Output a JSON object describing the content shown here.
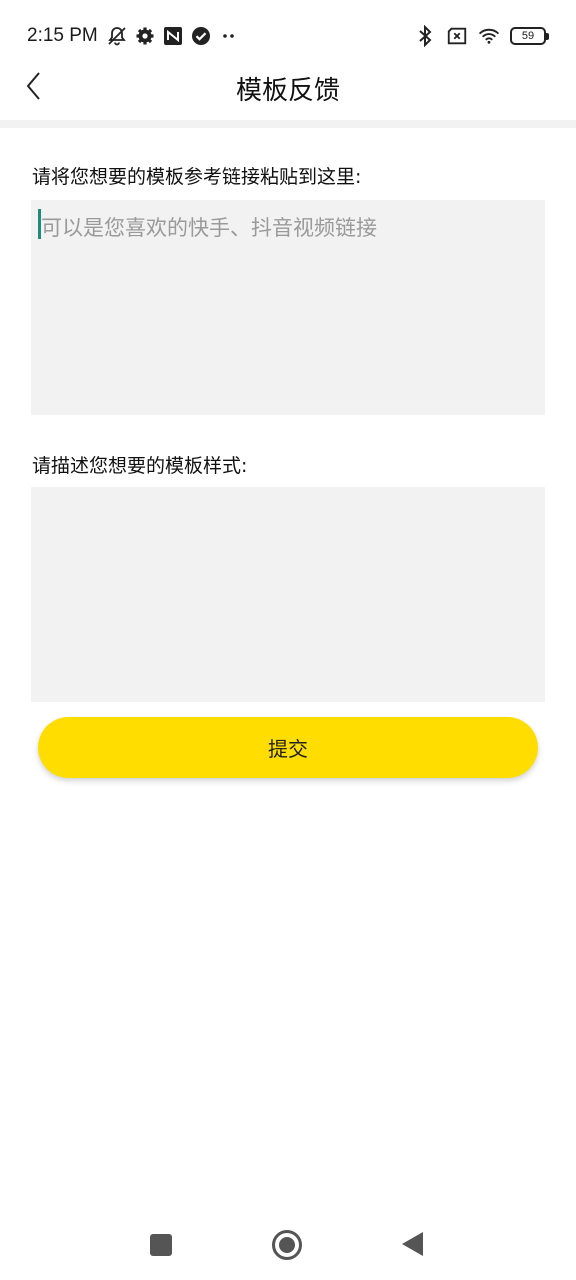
{
  "status_bar": {
    "time": "2:15 PM",
    "left_icons": [
      "bell-off-icon",
      "gear-icon",
      "nfc-icon",
      "check-circle-icon",
      "more-dots-icon"
    ],
    "right_icons": [
      "bluetooth-icon",
      "sim-off-icon",
      "wifi-icon"
    ],
    "battery": "59"
  },
  "header": {
    "title": "模板反馈",
    "back_icon": "chevron-left-icon"
  },
  "form": {
    "link_label": "请将您想要的模板参考链接粘贴到这里:",
    "link_placeholder": "可以是您喜欢的快手、抖音视频链接",
    "style_label": "请描述您想要的模板样式:",
    "style_value": "",
    "submit_label": "提交"
  },
  "colors": {
    "accent": "#ffdd00",
    "field_background": "#f2f2f2",
    "caret": "#1f8a7a"
  },
  "nav_bar": {
    "buttons": [
      "recents-button",
      "home-button",
      "back-button"
    ]
  }
}
